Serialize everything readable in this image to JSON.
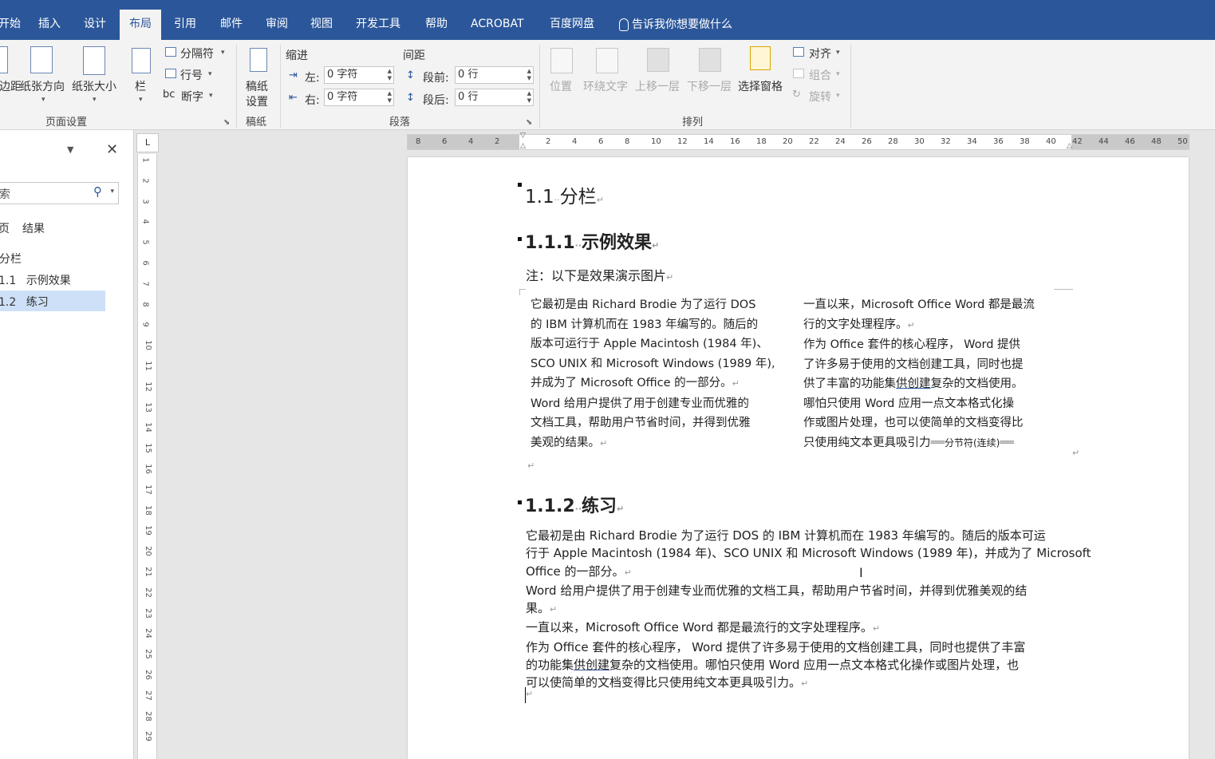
{
  "tabs": [
    "开始",
    "插入",
    "设计",
    "布局",
    "引用",
    "邮件",
    "审阅",
    "视图",
    "开发工具",
    "帮助",
    "ACROBAT",
    "百度网盘"
  ],
  "tell_me": "告诉我你想要做什么",
  "ribbon": {
    "page_setup": {
      "margins": "边距",
      "orientation": "纸张方向",
      "size": "纸张大小",
      "columns": "栏",
      "breaks": "分隔符",
      "line_numbers": "行号",
      "hyphenation": "断字",
      "group_label": "页面设置"
    },
    "manuscript": {
      "settings_line1": "稿纸",
      "settings_line2": "设置",
      "group_label": "稿纸"
    },
    "paragraph": {
      "indent_header": "缩进",
      "spacing_header": "间距",
      "indent_left_label": "左:",
      "indent_left_value": "0 字符",
      "indent_right_label": "右:",
      "indent_right_value": "0 字符",
      "spacing_before_label": "段前:",
      "spacing_before_value": "0 行",
      "spacing_after_label": "段后:",
      "spacing_after_value": "0 行",
      "group_label": "段落"
    },
    "arrange": {
      "position": "位置",
      "wrap_text": "环绕文字",
      "bring_forward": "上移一层",
      "send_backward": "下移一层",
      "selection_pane": "选择窗格",
      "align": "对齐",
      "group": "组合",
      "rotate": "旋转",
      "group_label": "排列"
    }
  },
  "nav": {
    "search_placeholder": "索",
    "tab_pages": "页",
    "tab_results": "结果",
    "items": [
      {
        "num": "",
        "label": "分栏"
      },
      {
        "num": "1.1",
        "label": "示例效果"
      },
      {
        "num": "1.2",
        "label": "练习"
      }
    ]
  },
  "ruler": {
    "corner": "L",
    "h_left_ticks": [
      "8",
      "6",
      "4",
      "2"
    ],
    "h_ticks": [
      "2",
      "4",
      "6",
      "8",
      "10",
      "12",
      "14",
      "16",
      "18",
      "20",
      "22",
      "24",
      "26",
      "28",
      "30",
      "32",
      "34",
      "36",
      "38",
      "40",
      "42",
      "44",
      "46",
      "48",
      "50"
    ],
    "v_ticks": [
      "1",
      "2",
      "3",
      "4",
      "5",
      "6",
      "7",
      "8",
      "9",
      "10",
      "11",
      "12",
      "13",
      "14",
      "15",
      "16",
      "17",
      "18",
      "19",
      "20",
      "21",
      "22",
      "23",
      "24",
      "25",
      "26",
      "27",
      "28",
      "29"
    ]
  },
  "document": {
    "h1_num": "1.1",
    "h1_text": "分栏",
    "h2a_num": "1.1.1",
    "h2a_text": "示例效果",
    "note": "注：以下是效果演示图片",
    "col1": [
      "它最初是由 Richard Brodie 为了运行 DOS",
      "的 IBM 计算机而在 1983 年编写的。随后的",
      "版本可运行于 Apple Macintosh (1984 年)、",
      "SCO UNIX 和 Microsoft Windows (1989 年),",
      "并成为了 Microsoft Office 的一部分。",
      "Word 给用户提供了用于创建专业而优雅的",
      "文档工具，帮助用户节省时间，并得到优雅",
      "美观的结果。"
    ],
    "col2": [
      "一直以来，Microsoft Office Word 都是最流",
      "行的文字处理程序。",
      "作为 Office 套件的核心程序， Word 提供",
      "了许多易于使用的文档创建工具，同时也提",
      "供了丰富的功能集",
      "供创建",
      "复杂的文档使用。",
      "哪怕只使用 Word 应用一点文本格式化操",
      "作或图片处理，也可以使简单的文档变得比",
      "只使用纯文本更具吸引力",
      "分节符(连续)"
    ],
    "h2b_num": "1.1.2",
    "h2b_text": "练习",
    "para_lines": [
      "它最初是由 Richard Brodie 为了运行 DOS 的 IBM 计算机而在 1983 年编写的。随后的版本可运",
      "行于 Apple Macintosh (1984 年)、SCO UNIX 和 Microsoft Windows (1989 年)，并成为了 Microsoft",
      "Office 的一部分。",
      "Word 给用户提供了用于创建专业而优雅的文档工具，帮助用户节省时间，并得到优雅美观的结",
      "果。",
      "一直以来，Microsoft Office Word 都是最流行的文字处理程序。",
      "作为 Office 套件的核心程序， Word 提供了许多易于使用的文档创建工具，同时也提供了丰富",
      "的功能集",
      "供创建",
      "复杂的文档使用。哪怕只使用 Word 应用一点文本格式化操作或图片处理，也",
      "可以使简单的文档变得比只使用纯文本更具吸引力。"
    ]
  }
}
